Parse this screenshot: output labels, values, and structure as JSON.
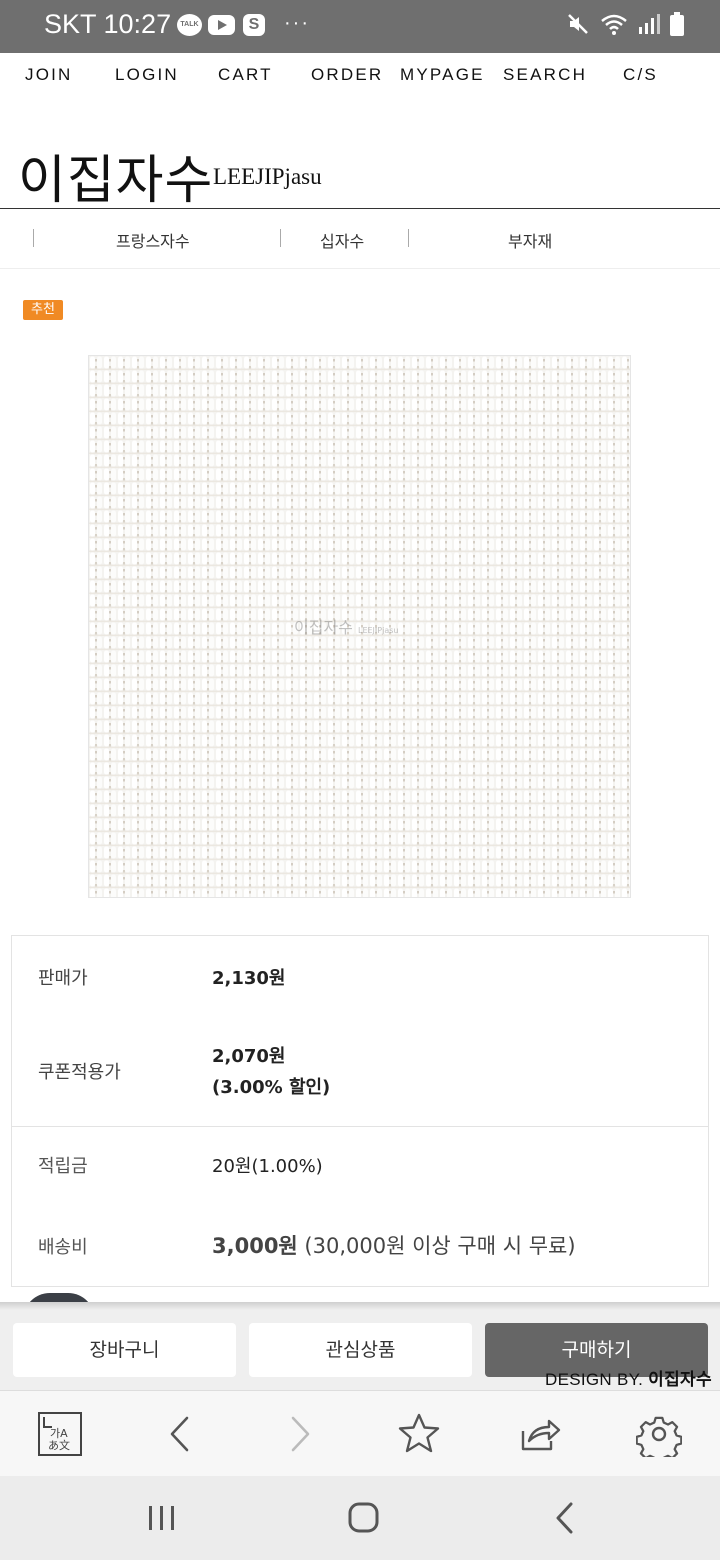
{
  "status_bar": {
    "carrier_time": "SKT 10:27",
    "talk_label": "TALK",
    "s_label": "S",
    "more": "···"
  },
  "top_nav": [
    "JOIN",
    "LOGIN",
    "CART",
    "ORDER",
    "MYPAGE",
    "SEARCH",
    "C/S"
  ],
  "logo": {
    "korean": "이집자수",
    "english": "LEEJIPjasu"
  },
  "categories": [
    "프랑스자수",
    "십자수",
    "부자재"
  ],
  "badge": "추천",
  "product_image": {
    "watermark": "이집자수",
    "watermark_small": "LEEJIPjasu"
  },
  "price": {
    "sale_label": "판매가",
    "sale_value": "2,130원",
    "coupon_label": "쿠폰적용가",
    "coupon_value": "2,070원",
    "coupon_discount": "(3.00% 할인)",
    "points_label": "적립금",
    "points_value": "20원(1.00%)",
    "shipping_label": "배송비",
    "shipping_value": "3,000원",
    "shipping_note": " (30,000원 이상 구매 시 무료)"
  },
  "actions": {
    "cart": "장바구니",
    "wishlist": "관심상품",
    "buy": "구매하기"
  },
  "footer_credit": {
    "prefix": "DESIGN BY. ",
    "name": "이집자수"
  },
  "browser_toolbar": {
    "translate_text": "가A\nあ文",
    "icons": [
      "translate-icon",
      "back-arrow-icon",
      "forward-arrow-icon",
      "bookmark-star-icon",
      "share-icon",
      "settings-gear-icon"
    ]
  },
  "android_nav": [
    "recents-icon",
    "home-icon",
    "back-icon"
  ]
}
